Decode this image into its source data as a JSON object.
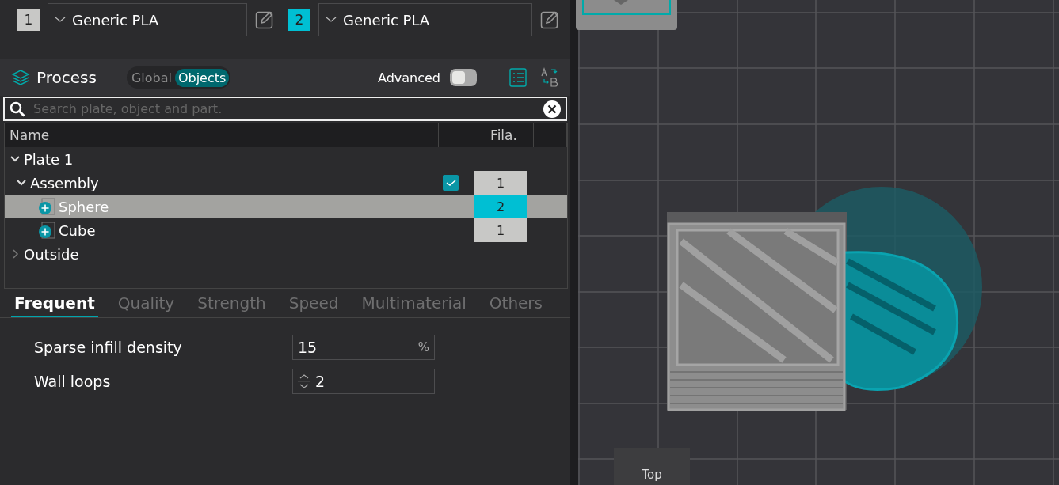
{
  "filaments": [
    {
      "number": "1",
      "color": "#c8c8c6",
      "material": "Generic PLA"
    },
    {
      "number": "2",
      "color": "#00bfd3",
      "material": "Generic PLA"
    }
  ],
  "process": {
    "title": "Process",
    "scope_tabs": [
      {
        "label": "Global",
        "selected": false
      },
      {
        "label": "Objects",
        "selected": true
      }
    ],
    "advanced": {
      "label": "Advanced",
      "on": false
    }
  },
  "search": {
    "placeholder": "Search plate, object and part."
  },
  "object_list": {
    "columns": [
      "Name",
      "",
      "Fila."
    ],
    "items": [
      {
        "name": "Plate 1",
        "expanded": true,
        "selected": false,
        "children": [
          {
            "name": "Assembly",
            "expanded": true,
            "selected": false,
            "checked": true,
            "filament": "1",
            "color": "#c8c8c6",
            "children": [
              {
                "name": "Sphere",
                "kind": "part",
                "selected": true,
                "filament": "2",
                "color": "#00bfd3"
              },
              {
                "name": "Cube",
                "kind": "part",
                "selected": false,
                "filament": "1",
                "color": "#c8c8c6"
              }
            ]
          }
        ]
      },
      {
        "name": "Outside",
        "expanded": false,
        "selected": false
      }
    ]
  },
  "setting_tabs": [
    {
      "label": "Frequent",
      "selected": true
    },
    {
      "label": "Quality",
      "selected": false
    },
    {
      "label": "Strength",
      "selected": false
    },
    {
      "label": "Speed",
      "selected": false
    },
    {
      "label": "Multimaterial",
      "selected": false
    },
    {
      "label": "Others",
      "selected": false
    }
  ],
  "settings": [
    {
      "label": "Sparse infill density",
      "kind": "unit",
      "value": "15",
      "unit": "%"
    },
    {
      "label": "Wall loops",
      "kind": "spin",
      "value": "2"
    }
  ],
  "viewport": {
    "view_label": "Top"
  }
}
